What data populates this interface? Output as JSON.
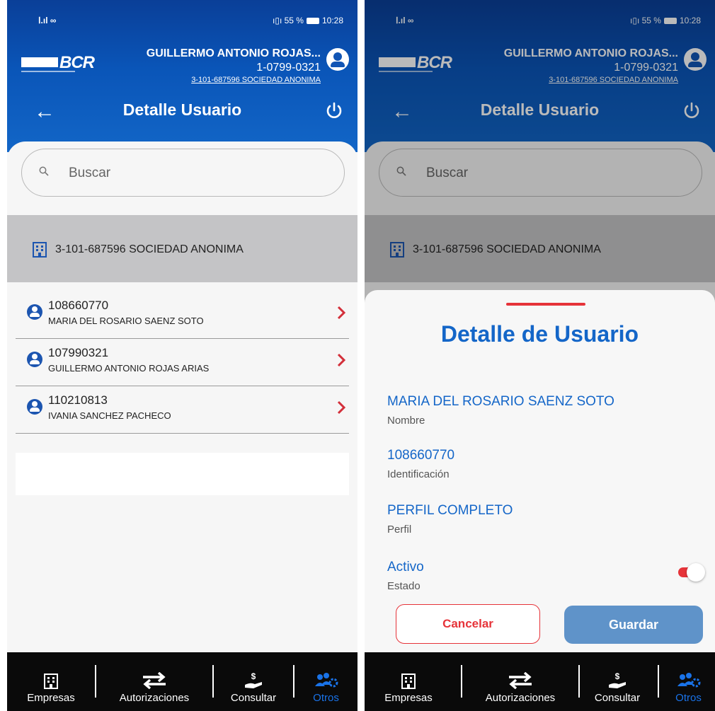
{
  "status_bar": {
    "signal": "ⵏ.ıl ∞",
    "right": "ı▯ı 55 %",
    "time": "10:28"
  },
  "header": {
    "logo_text": "BCR",
    "user_name": "GUILLERMO ANTONIO ROJAS...",
    "user_id": "1-0799-0321",
    "company_link": "3-101-687596 SOCIEDAD ANONIMA",
    "title": "Detalle Usuario",
    "icons": {
      "back": "arrow-left-icon",
      "power": "power-icon",
      "avatar": "user-circle-icon"
    }
  },
  "search": {
    "placeholder": "Buscar",
    "value": ""
  },
  "company_band": {
    "icon": "building-icon",
    "name": "3-101-687596 SOCIEDAD ANONIMA"
  },
  "users": [
    {
      "id": "108660770",
      "name": "MARIA DEL ROSARIO SAENZ SOTO"
    },
    {
      "id": "107990321",
      "name": "GUILLERMO ANTONIO ROJAS ARIAS"
    },
    {
      "id": "110210813",
      "name": "IVANIA SANCHEZ PACHECO"
    }
  ],
  "bottom_nav": {
    "items": [
      {
        "label": "Empresas",
        "icon": "building-icon"
      },
      {
        "label": "Autorizaciones",
        "icon": "swap-arrows-icon"
      },
      {
        "label": "Consultar",
        "icon": "hand-money-icon"
      },
      {
        "label": "Otros",
        "icon": "people-gear-icon"
      }
    ],
    "active": "Otros",
    "active_color": "#1a73e8"
  },
  "detail_sheet": {
    "title": "Detalle de Usuario",
    "fields": [
      {
        "value": "MARIA DEL ROSARIO SAENZ SOTO",
        "label": "Nombre"
      },
      {
        "value": "108660770",
        "label": "Identificación"
      },
      {
        "value": "PERFIL COMPLETO",
        "label": "Perfil"
      },
      {
        "value": "Activo",
        "label": "Estado"
      }
    ],
    "toggle_on": true,
    "cancel_label": "Cancelar",
    "save_label": "Guardar"
  },
  "colors": {
    "header_blue": "#0a55b8",
    "accent_blue": "#1466c8",
    "accent_red": "#e63339",
    "save_button": "#5f93c9"
  }
}
